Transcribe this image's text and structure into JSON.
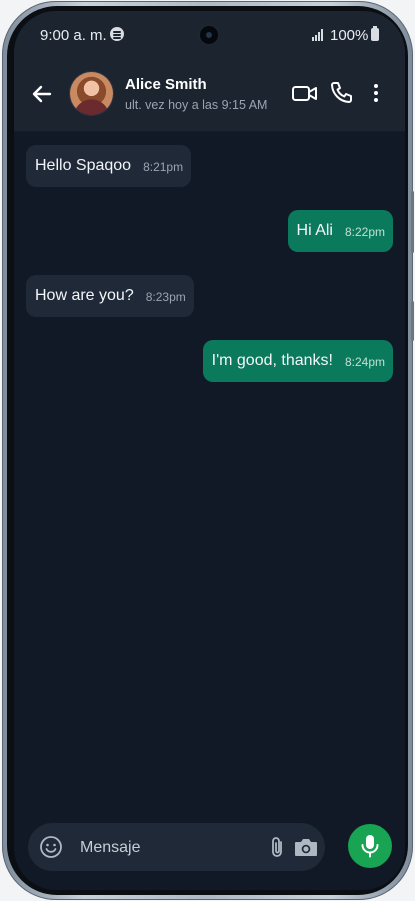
{
  "status_bar": {
    "time": "9:00 a. m.",
    "battery": "100%",
    "icons": [
      "spotify-icon",
      "signal-icon",
      "battery-icon"
    ]
  },
  "header": {
    "name": "Alice Smith",
    "status": "ult. vez hoy a las 9:15 AM",
    "icons": [
      "back-arrow-icon",
      "video-call-icon",
      "phone-icon",
      "more-vert-icon"
    ]
  },
  "messages": [
    {
      "direction": "in",
      "text": "Hello Spaqoo",
      "time": "8:21pm"
    },
    {
      "direction": "out",
      "text": "Hi Ali",
      "time": "8:22pm"
    },
    {
      "direction": "in",
      "text": "How are you?",
      "time": "8:23pm"
    },
    {
      "direction": "out",
      "text": "I'm good, thanks!",
      "time": "8:24pm"
    }
  ],
  "composer": {
    "placeholder": "Mensaje",
    "value": "",
    "icons": [
      "emoji-icon",
      "attach-icon",
      "camera-icon",
      "mic-icon"
    ]
  },
  "colors": {
    "background": "#111926",
    "header": "#1c2430",
    "incoming_bubble": "#1f2937",
    "outgoing_bubble": "#0b7a5c",
    "mic_button": "#18a452"
  }
}
